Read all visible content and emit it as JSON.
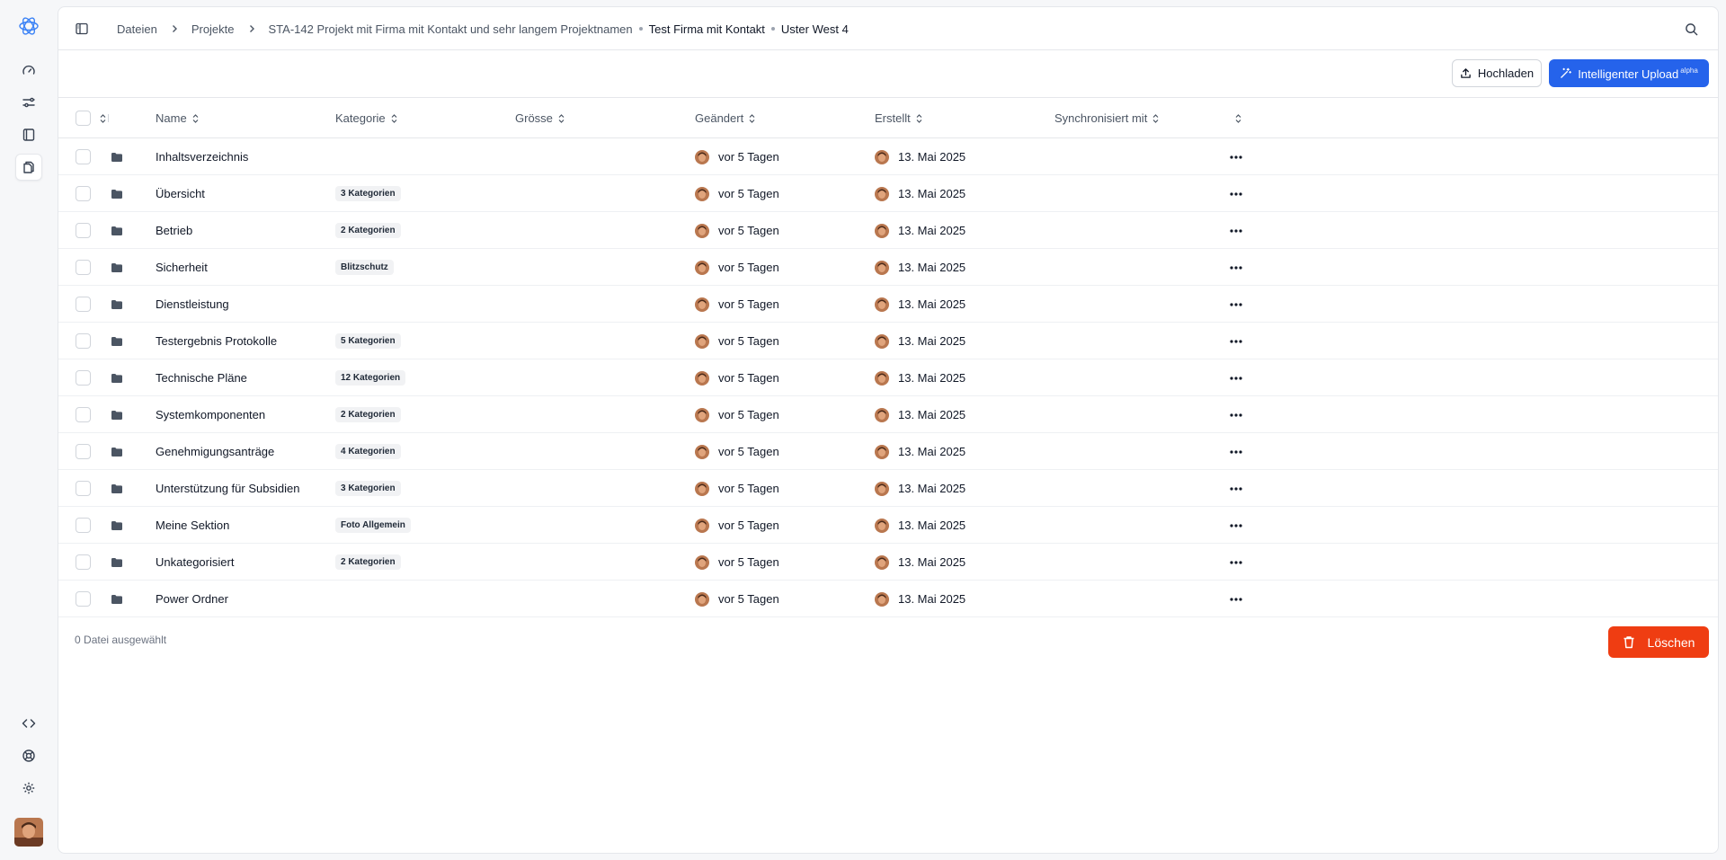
{
  "breadcrumb": {
    "items": [
      "Dateien",
      "Projekte",
      "STA-142 Projekt mit Firma mit Kontakt und sehr langem Projektnamen",
      "Test Firma mit Kontakt",
      "Uster West 4"
    ]
  },
  "toolbar": {
    "upload_label": "Hochladen",
    "smart_upload_label": "Intelligenter Upload",
    "smart_upload_tag": "alpha"
  },
  "table": {
    "columns": {
      "name": "Name",
      "category": "Kategorie",
      "size": "Grösse",
      "modified": "Geändert",
      "created": "Erstellt",
      "synced": "Synchronisiert mit"
    },
    "rows": [
      {
        "name": "Inhaltsverzeichnis",
        "category": "",
        "modified": "vor 5 Tagen",
        "created": "13. Mai 2025"
      },
      {
        "name": "Übersicht",
        "category": "3 Kategorien",
        "modified": "vor 5 Tagen",
        "created": "13. Mai 2025"
      },
      {
        "name": "Betrieb",
        "category": "2 Kategorien",
        "modified": "vor 5 Tagen",
        "created": "13. Mai 2025"
      },
      {
        "name": "Sicherheit",
        "category": "Blitzschutz",
        "modified": "vor 5 Tagen",
        "created": "13. Mai 2025"
      },
      {
        "name": "Dienstleistung",
        "category": "",
        "modified": "vor 5 Tagen",
        "created": "13. Mai 2025"
      },
      {
        "name": "Testergebnis Protokolle",
        "category": "5 Kategorien",
        "modified": "vor 5 Tagen",
        "created": "13. Mai 2025"
      },
      {
        "name": "Technische Pläne",
        "category": "12 Kategorien",
        "modified": "vor 5 Tagen",
        "created": "13. Mai 2025"
      },
      {
        "name": "Systemkomponenten",
        "category": "2 Kategorien",
        "modified": "vor 5 Tagen",
        "created": "13. Mai 2025"
      },
      {
        "name": "Genehmigungsanträge",
        "category": "4 Kategorien",
        "modified": "vor 5 Tagen",
        "created": "13. Mai 2025"
      },
      {
        "name": "Unterstützung für Subsidien",
        "category": "3 Kategorien",
        "modified": "vor 5 Tagen",
        "created": "13. Mai 2025"
      },
      {
        "name": "Meine Sektion",
        "category": "Foto Allgemein",
        "modified": "vor 5 Tagen",
        "created": "13. Mai 2025"
      },
      {
        "name": "Unkategorisiert",
        "category": "2 Kategorien",
        "modified": "vor 5 Tagen",
        "created": "13. Mai 2025"
      },
      {
        "name": "Power Ordner",
        "category": "",
        "modified": "vor 5 Tagen",
        "created": "13. Mai 2025"
      }
    ]
  },
  "footer": {
    "selection_count": "0",
    "selection_text": "Datei ausgewählt",
    "delete_label": "Löschen"
  },
  "rail": {
    "icons": [
      "logo-icon",
      "dashboard-icon",
      "settings-sliders-icon",
      "book-icon",
      "files-icon",
      "code-icon",
      "help-icon",
      "gear-icon"
    ]
  },
  "colors": {
    "primary": "#2563eb",
    "danger": "#ef3d12",
    "border": "#e5e7eb",
    "badge_bg": "#f1f2f4"
  }
}
